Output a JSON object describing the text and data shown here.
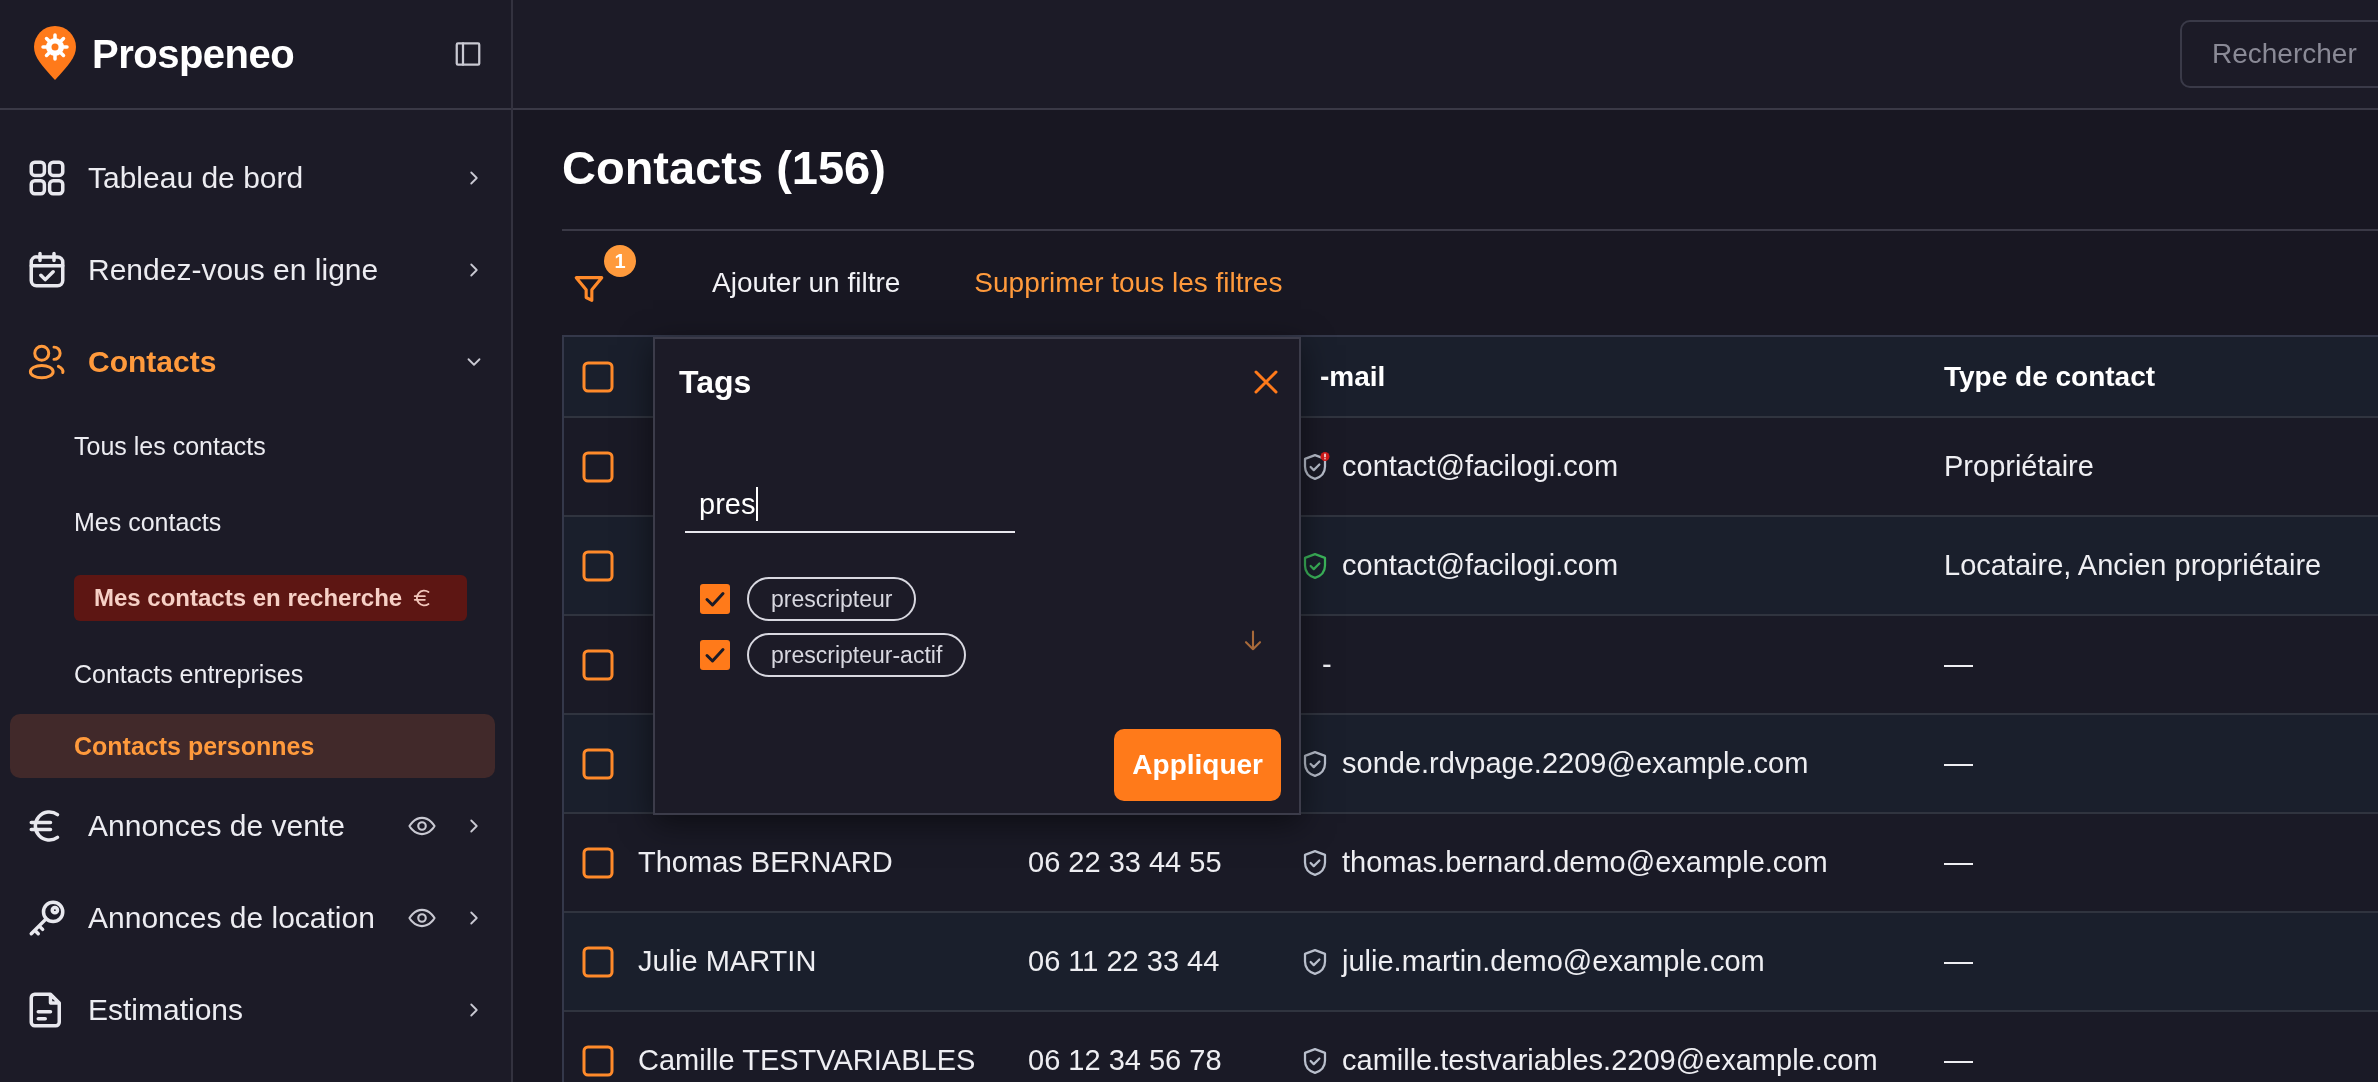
{
  "sidebar": {
    "brand": "Prospeneo",
    "nav": [
      {
        "label": "Tableau de bord",
        "active": false,
        "expanded": false,
        "eye": false
      },
      {
        "label": "Rendez-vous en ligne",
        "active": false,
        "expanded": false,
        "eye": false
      },
      {
        "label": "Contacts",
        "active": true,
        "expanded": true,
        "eye": false,
        "children": [
          {
            "label": "Tous les contacts",
            "kind": "plain",
            "selected": false
          },
          {
            "label": "Mes contacts",
            "kind": "plain",
            "selected": false
          },
          {
            "label": "Mes contacts en recherche",
            "kind": "premium",
            "selected": false
          },
          {
            "label": "Contacts entreprises",
            "kind": "plain",
            "selected": false
          },
          {
            "label": "Contacts personnes",
            "kind": "plain",
            "selected": true
          }
        ]
      },
      {
        "label": "Annonces de vente",
        "active": false,
        "expanded": false,
        "eye": true
      },
      {
        "label": "Annonces de location",
        "active": false,
        "expanded": false,
        "eye": true
      },
      {
        "label": "Estimations",
        "active": false,
        "expanded": false,
        "eye": false
      }
    ]
  },
  "topbar": {
    "search": {
      "placeholder": "Rechercher"
    }
  },
  "page": {
    "title": "Contacts (156)"
  },
  "filters": {
    "count": "1",
    "add": "Ajouter un filtre",
    "clear": "Supprimer tous les filtres"
  },
  "table": {
    "all_checked": false,
    "columns": [
      "-mail",
      "Type de contact"
    ],
    "rows": [
      {
        "checked": false,
        "email": "contact@facilogi.com",
        "email_verified": false,
        "email_warning": true,
        "type": "Propriétaire"
      },
      {
        "checked": false,
        "email": "contact@facilogi.com",
        "email_verified": true,
        "email_warning": false,
        "type": "Locataire, Ancien propriétaire"
      },
      {
        "checked": false,
        "email": "-",
        "type": "—"
      },
      {
        "checked": false,
        "email": "sonde.rdvpage.2209@example.com",
        "email_verified": false,
        "email_warning": false,
        "type": "—"
      },
      {
        "checked": false,
        "name": "Thomas BERNARD",
        "phone": "06 22 33 44 55",
        "email": "thomas.bernard.demo@example.com",
        "email_verified": false,
        "email_warning": false,
        "type": "—"
      },
      {
        "checked": false,
        "name": "Julie MARTIN",
        "phone": "06 11 22 33 44",
        "email": "julie.martin.demo@example.com",
        "email_verified": false,
        "email_warning": false,
        "type": "—"
      },
      {
        "checked": false,
        "name": "Camille TESTVARIABLES",
        "phone": "06 12 34 56 78",
        "email": "camille.testvariables.2209@example.com",
        "email_verified": false,
        "email_warning": false,
        "type": "—"
      }
    ]
  },
  "tag_popup": {
    "title": "Tags",
    "query": "pres",
    "options": [
      {
        "label": "prescripteur",
        "checked": true
      },
      {
        "label": "prescripteur-actif",
        "checked": true
      }
    ],
    "apply": "Appliquer"
  }
}
